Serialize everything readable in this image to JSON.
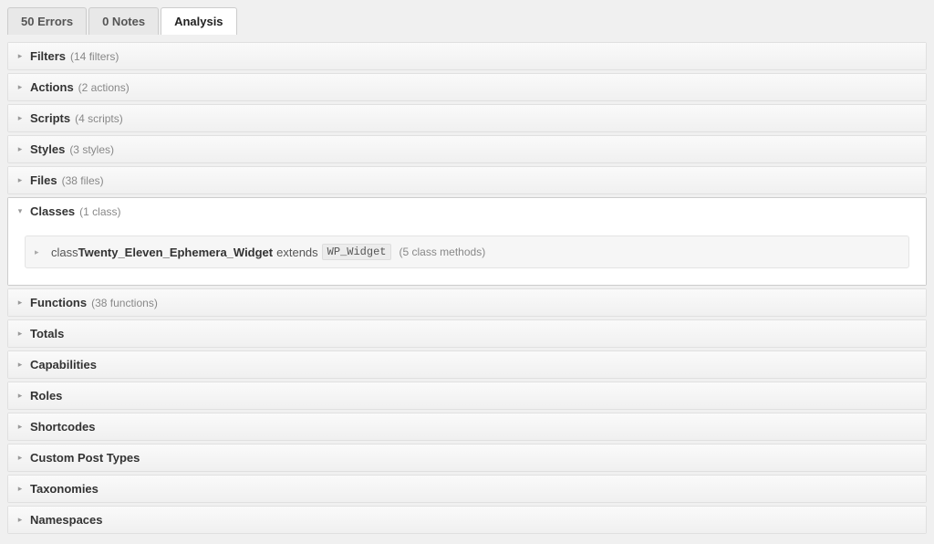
{
  "tabs": [
    {
      "label": "50 Errors",
      "active": false
    },
    {
      "label": "0 Notes",
      "active": false
    },
    {
      "label": "Analysis",
      "active": true
    }
  ],
  "sections": [
    {
      "title": "Filters",
      "count": "(14 filters)",
      "expanded": false
    },
    {
      "title": "Actions",
      "count": "(2 actions)",
      "expanded": false
    },
    {
      "title": "Scripts",
      "count": "(4 scripts)",
      "expanded": false
    },
    {
      "title": "Styles",
      "count": "(3 styles)",
      "expanded": false
    },
    {
      "title": "Files",
      "count": "(38 files)",
      "expanded": false
    },
    {
      "title": "Classes",
      "count": "(1 class)",
      "expanded": true,
      "class_row": {
        "keyword": "class",
        "name": "Twenty_Eleven_Ephemera_Widget",
        "extends_keyword": "extends",
        "parent": "WP_Widget",
        "methods": "(5 class methods)"
      }
    },
    {
      "title": "Functions",
      "count": "(38 functions)",
      "expanded": false
    },
    {
      "title": "Totals",
      "count": "",
      "expanded": false
    },
    {
      "title": "Capabilities",
      "count": "",
      "expanded": false
    },
    {
      "title": "Roles",
      "count": "",
      "expanded": false
    },
    {
      "title": "Shortcodes",
      "count": "",
      "expanded": false
    },
    {
      "title": "Custom Post Types",
      "count": "",
      "expanded": false
    },
    {
      "title": "Taxonomies",
      "count": "",
      "expanded": false
    },
    {
      "title": "Namespaces",
      "count": "",
      "expanded": false
    }
  ],
  "glyphs": {
    "right": "▸",
    "down": "▾"
  }
}
